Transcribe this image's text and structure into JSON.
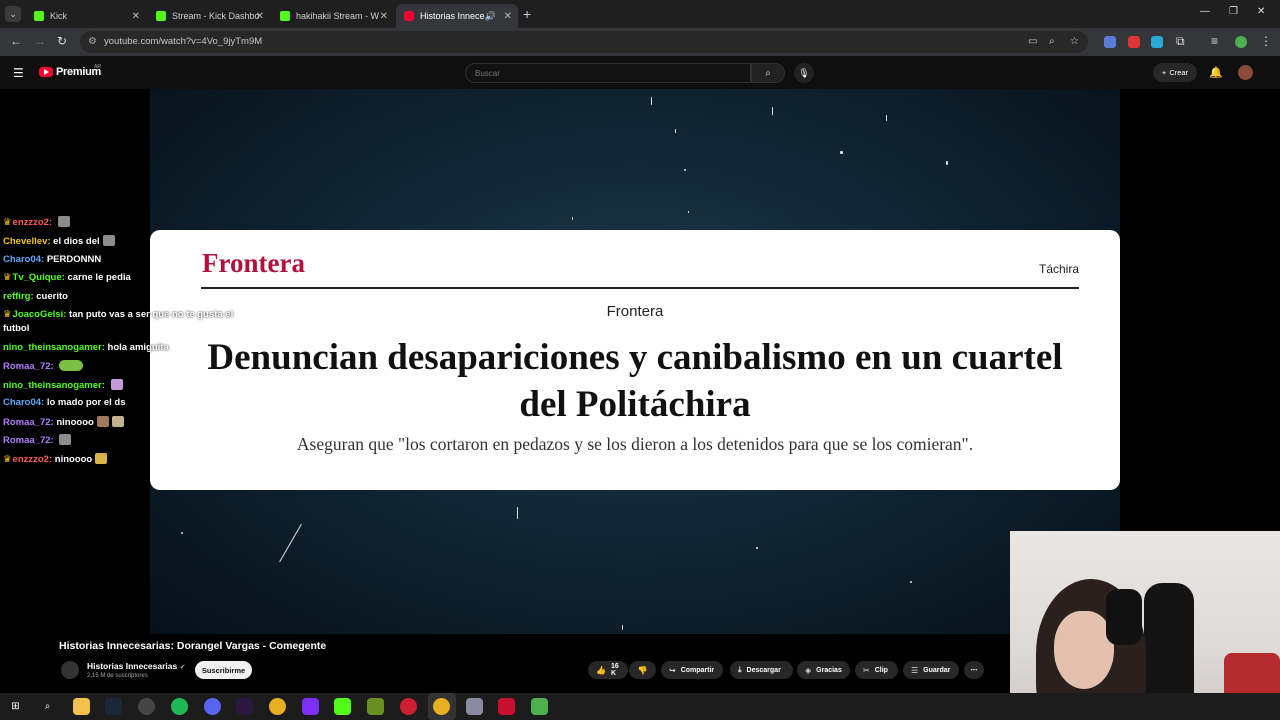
{
  "browser": {
    "tabs": [
      {
        "title": "Kick",
        "favicon": "kick-icon"
      },
      {
        "title": "Stream - Kick Dashbo",
        "favicon": "kick-icon"
      },
      {
        "title": "hakihakii Stream - W",
        "favicon": "kick-icon"
      },
      {
        "title": "Historias Innece",
        "favicon": "youtube-icon",
        "active": true
      }
    ],
    "url": "youtube.com/watch?v=4Vo_9jyTm9M"
  },
  "yt": {
    "brand": "Premium",
    "region": "AR",
    "search_placeholder": "Buscar",
    "create_label": "Crear"
  },
  "article": {
    "logo": "Frontera",
    "nav": "Táchira",
    "source": "Frontera",
    "headline": "Denuncian desapariciones y canibalismo en un cuartel del Politáchira",
    "subhead": "Aseguran que \"los cortaron en pedazos y se los dieron a los detenidos para que se los comieran\"."
  },
  "chat": [
    {
      "user": "enzzzo2:",
      "color": "#ff5a5a",
      "crown": true,
      "msg": "",
      "emote": true
    },
    {
      "user": "Chevellev:",
      "color": "#f5c518",
      "crown": false,
      "msg": "el dios del",
      "emote": true
    },
    {
      "user": "Charo04:",
      "color": "#5fa8ff",
      "crown": false,
      "msg": "PERDONNN",
      "emote": false
    },
    {
      "user": "Tv_Quique:",
      "color": "#53fc18",
      "crown": true,
      "msg": "carne le pedia",
      "emote": false
    },
    {
      "user": "reffirg:",
      "color": "#53fc18",
      "crown": false,
      "msg": "cuerito",
      "emote": false
    },
    {
      "user": "JoacoGelsi:",
      "color": "#53fc18",
      "crown": true,
      "msg": "tan puto vas a ser que no te gusta el",
      "emote": false
    },
    {
      "user": "",
      "color": "#ffffff",
      "crown": false,
      "msg": "futbol",
      "emote": false
    },
    {
      "user": "nino_theinsanogamer:",
      "color": "#53fc18",
      "crown": false,
      "msg": "hola amiguita",
      "emote": false
    },
    {
      "user": "nino_theinsanogamer:",
      "color": "#53fc18",
      "crown": false,
      "msg": "",
      "emote": true
    },
    {
      "user": "Romaa_72:",
      "color": "#b47cff",
      "crown": false,
      "msg": "",
      "emote": true
    },
    {
      "user": "Charo04:",
      "color": "#5fa8ff",
      "crown": false,
      "msg": "lo mado por el ds",
      "emote": false
    },
    {
      "user": "Romaa_72:",
      "color": "#b47cff",
      "crown": false,
      "msg": "ninoooo",
      "emote": true
    },
    {
      "user": "Romaa_72:",
      "color": "#b47cff",
      "crown": false,
      "msg": "",
      "emote": true
    },
    {
      "user": "enzzzo2:",
      "color": "#ff5a5a",
      "crown": true,
      "msg": "ninoooo",
      "emote": true
    }
  ],
  "video": {
    "title": "Historias Innecesarias: Dorangel Vargas - Comegente",
    "channel": "Historias Innecesarias",
    "subscribers": "2,15 M de suscriptores",
    "subscribe_label": "Suscribirme",
    "likes": "16 K",
    "actions": [
      "Compartir",
      "Descargar",
      "Gracias",
      "Clip",
      "Guardar"
    ]
  }
}
